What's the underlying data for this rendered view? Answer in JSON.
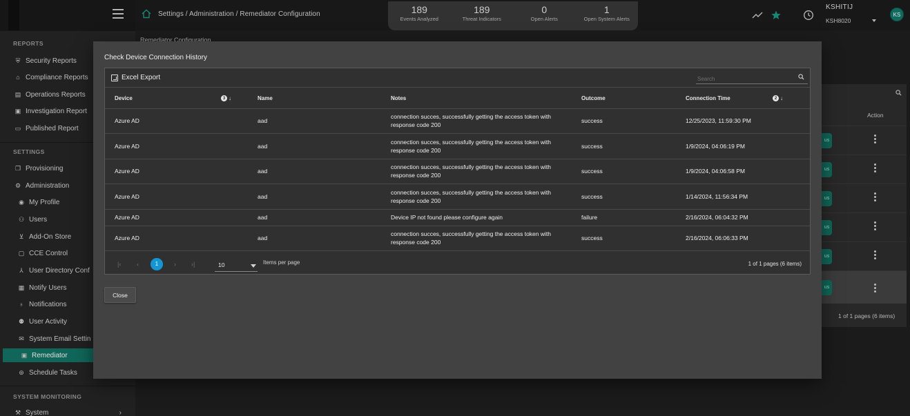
{
  "header": {
    "breadcrumb": "Settings / Administration / Remediator Configuration",
    "stats": [
      {
        "value": "189",
        "label": "Events Analyzed"
      },
      {
        "value": "189",
        "label": "Threat Indicators"
      },
      {
        "value": "0",
        "label": "Open Alerts"
      },
      {
        "value": "1",
        "label": "Open System Alerts"
      }
    ],
    "user_name": "KSHITIJ",
    "user_id": "KSH8020",
    "avatar_initials": "KS",
    "icons": [
      "menu-icon",
      "home-icon",
      "trend-icon",
      "star-icon",
      "clock-icon"
    ]
  },
  "sidebar": {
    "sections": {
      "reports": "REPORTS",
      "settings": "SETTINGS",
      "monitoring": "SYSTEM MONITORING"
    },
    "report_items": [
      {
        "label": "Security Reports",
        "icon": "shield-icon"
      },
      {
        "label": "Compliance Reports",
        "icon": "bank-icon"
      },
      {
        "label": "Operations Reports",
        "icon": "document-icon"
      },
      {
        "label": "Investigation Report",
        "icon": "monitor-icon"
      },
      {
        "label": "Published Report",
        "icon": "laptop-icon"
      }
    ],
    "settings_items": [
      {
        "label": "Provisioning",
        "icon": "copy-icon"
      },
      {
        "label": "Administration",
        "icon": "gear-icon"
      }
    ],
    "admin_items": [
      {
        "label": "My Profile",
        "icon": "user-circle-icon"
      },
      {
        "label": "Users",
        "icon": "users-icon"
      },
      {
        "label": "Add-On Store",
        "icon": "cart-icon"
      },
      {
        "label": "CCE Control",
        "icon": "window-icon"
      },
      {
        "label": "User Directory Conf",
        "icon": "directory-icon"
      },
      {
        "label": "Notify Users",
        "icon": "notify-icon"
      },
      {
        "label": "Notifications",
        "icon": "bell-icon"
      },
      {
        "label": "User Activity",
        "icon": "activity-icon"
      },
      {
        "label": "System Email Settin",
        "icon": "mail-icon"
      },
      {
        "label": "Remediator",
        "icon": "remediator-icon"
      },
      {
        "label": "Schedule Tasks",
        "icon": "schedule-icon"
      }
    ],
    "monitoring_items": [
      {
        "label": "System",
        "icon": "wrench-icon"
      }
    ]
  },
  "background": {
    "page_title": "Remediator Configuration",
    "action_header": "Action",
    "pill_text": "us",
    "pager_info": "1 of 1 pages (6 items)"
  },
  "modal": {
    "title": "Check Device Connection History",
    "export_label": "Excel Export",
    "search_placeholder": "Search",
    "columns": [
      "Device",
      "Name",
      "Notes",
      "Outcome",
      "Connection Time"
    ],
    "sort_badges": {
      "device": "3",
      "connection_time": "2"
    },
    "rows": [
      {
        "device": "Azure AD",
        "name": "aad",
        "notes": "connection succes, successfully getting the access token with response code 200",
        "outcome": "success",
        "time": "12/25/2023, 11:59:30 PM"
      },
      {
        "device": "Azure AD",
        "name": "aad",
        "notes": "connection succes, successfully getting the access token with response code 200",
        "outcome": "success",
        "time": "1/9/2024, 04:06:19 PM"
      },
      {
        "device": "Azure AD",
        "name": "aad",
        "notes": "connection succes, successfully getting the access token with response code 200",
        "outcome": "success",
        "time": "1/9/2024, 04:06:58 PM"
      },
      {
        "device": "Azure AD",
        "name": "aad",
        "notes": "connection succes, successfully getting the access token with response code 200",
        "outcome": "success",
        "time": "1/14/2024, 11:56:34 PM"
      },
      {
        "device": "Azure AD",
        "name": "aad",
        "notes": "Device IP not found please configure again",
        "outcome": "failure",
        "time": "2/16/2024, 06:04:32 PM"
      },
      {
        "device": "Azure AD",
        "name": "aad",
        "notes": "connection succes, successfully getting the access token with response code 200",
        "outcome": "success",
        "time": "2/16/2024, 06:06:33 PM"
      }
    ],
    "pager": {
      "current_page": "1",
      "page_size": "10",
      "per_page_label": "Items per page",
      "info": "1 of 1 pages (6 items)"
    },
    "close_label": "Close"
  },
  "colors": {
    "accent": "#137565",
    "page_active": "#1596d4",
    "modal_bg": "#424242"
  }
}
